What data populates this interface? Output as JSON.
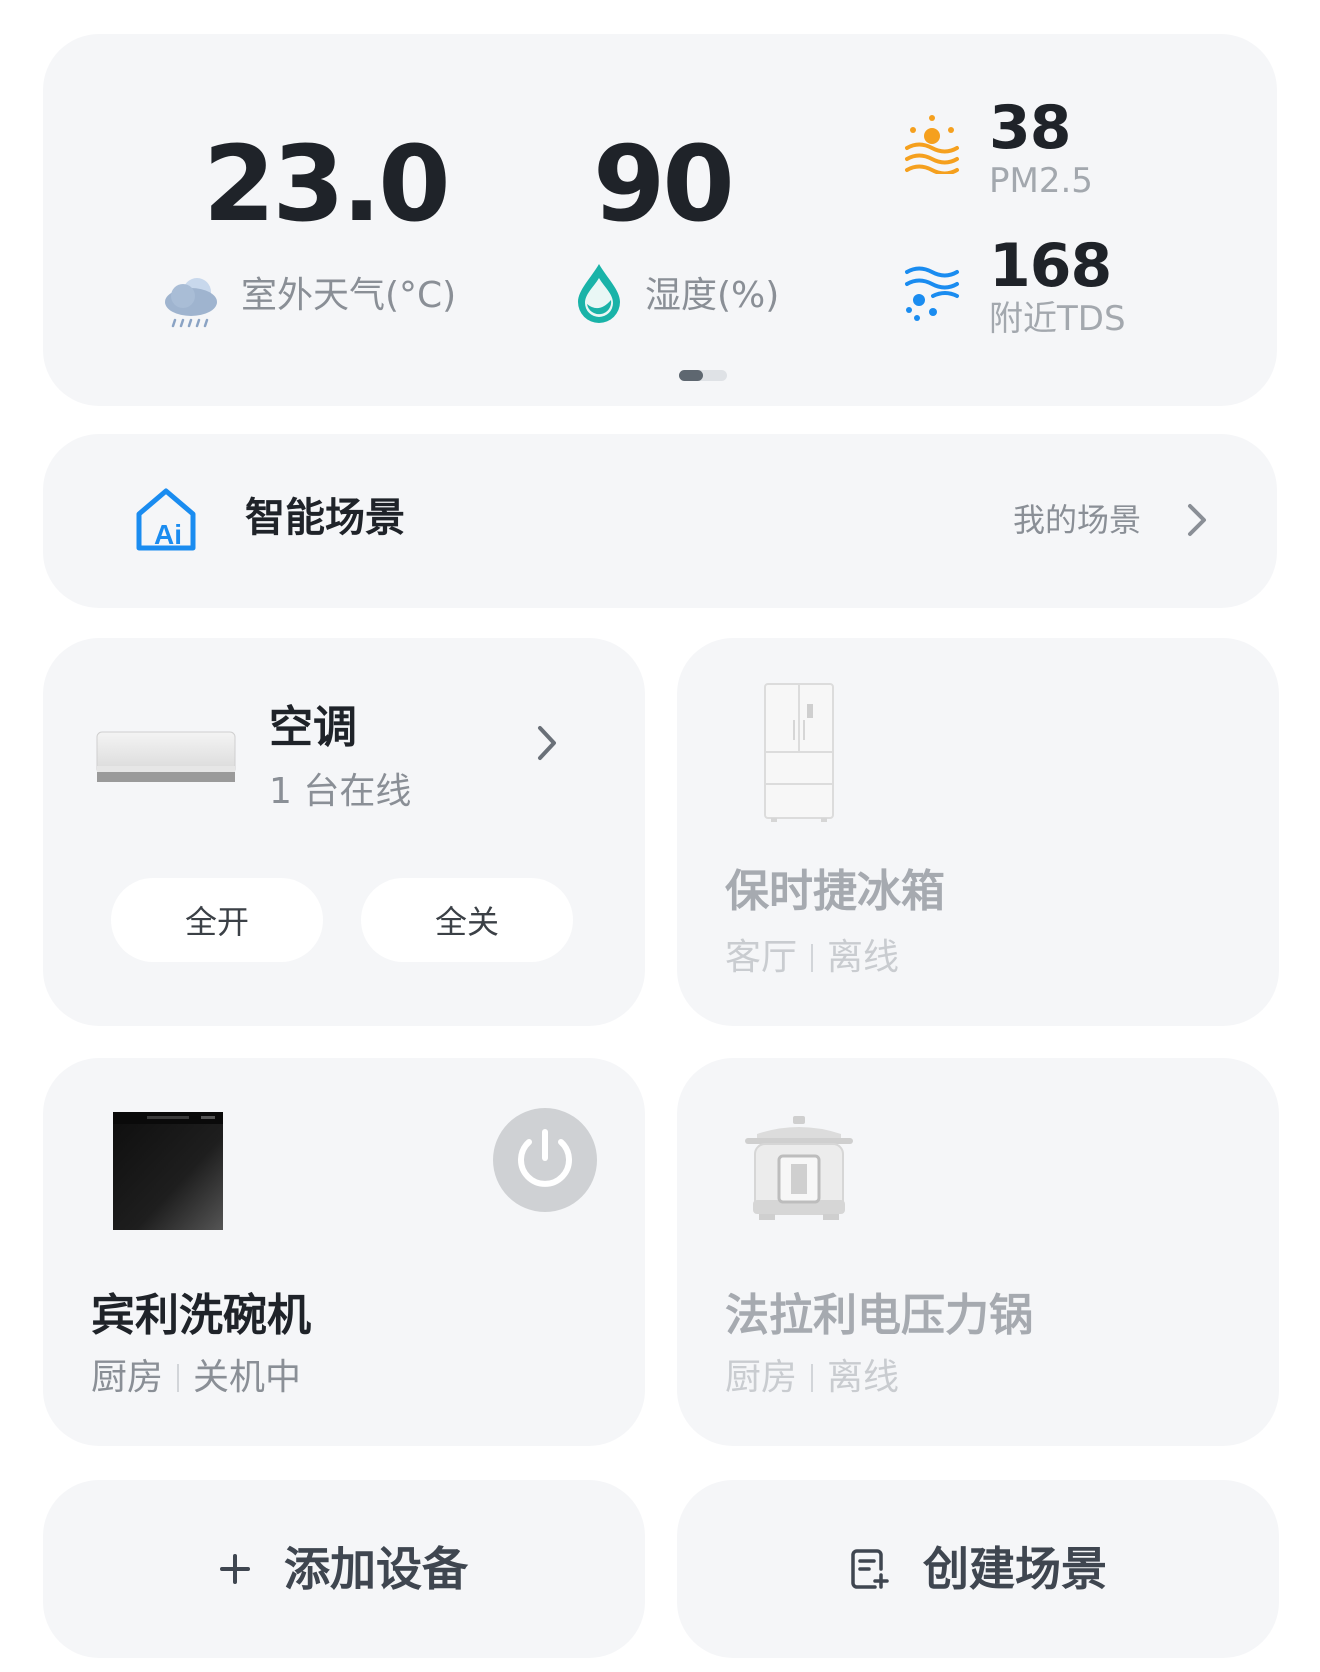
{
  "environment": {
    "outdoor": {
      "value": "23.0",
      "label": "室外天气(°C)",
      "icon": "cloud-rain-icon"
    },
    "humidity": {
      "value": "90",
      "label": "湿度(%)",
      "icon": "water-drop-icon"
    },
    "pm25": {
      "value": "38",
      "label": "PM2.5",
      "icon": "haze-sun-icon"
    },
    "tds": {
      "value": "168",
      "label": "附近TDS",
      "icon": "water-waves-icon"
    },
    "pager": {
      "pages": 2,
      "current": 1
    }
  },
  "scene": {
    "title": "智能场景",
    "link": "我的场景",
    "icon": "ai-home-icon"
  },
  "devices": {
    "ac": {
      "name": "空调",
      "status": "1 台在线",
      "on_label": "全开",
      "off_label": "全关",
      "icon": "air-conditioner-icon"
    },
    "fridge": {
      "name": "保时捷冰箱",
      "room": "客厅",
      "state": "离线",
      "icon": "refrigerator-icon"
    },
    "dishwasher": {
      "name": "宾利洗碗机",
      "room": "厨房",
      "state": "关机中",
      "icon": "dishwasher-icon"
    },
    "cooker": {
      "name": "法拉利电压力锅",
      "room": "厨房",
      "state": "离线",
      "icon": "pressure-cooker-icon"
    }
  },
  "actions": {
    "add": {
      "label": "添加设备",
      "icon": "plus-icon"
    },
    "create": {
      "label": "创建场景",
      "icon": "scene-add-icon"
    }
  },
  "colors": {
    "card_bg": "#f5f6f8",
    "accent_blue": "#1a8cf0",
    "teal": "#19b3a8",
    "orange": "#f5a01e",
    "text_primary": "#1f2329",
    "text_secondary": "#8a8f96"
  }
}
